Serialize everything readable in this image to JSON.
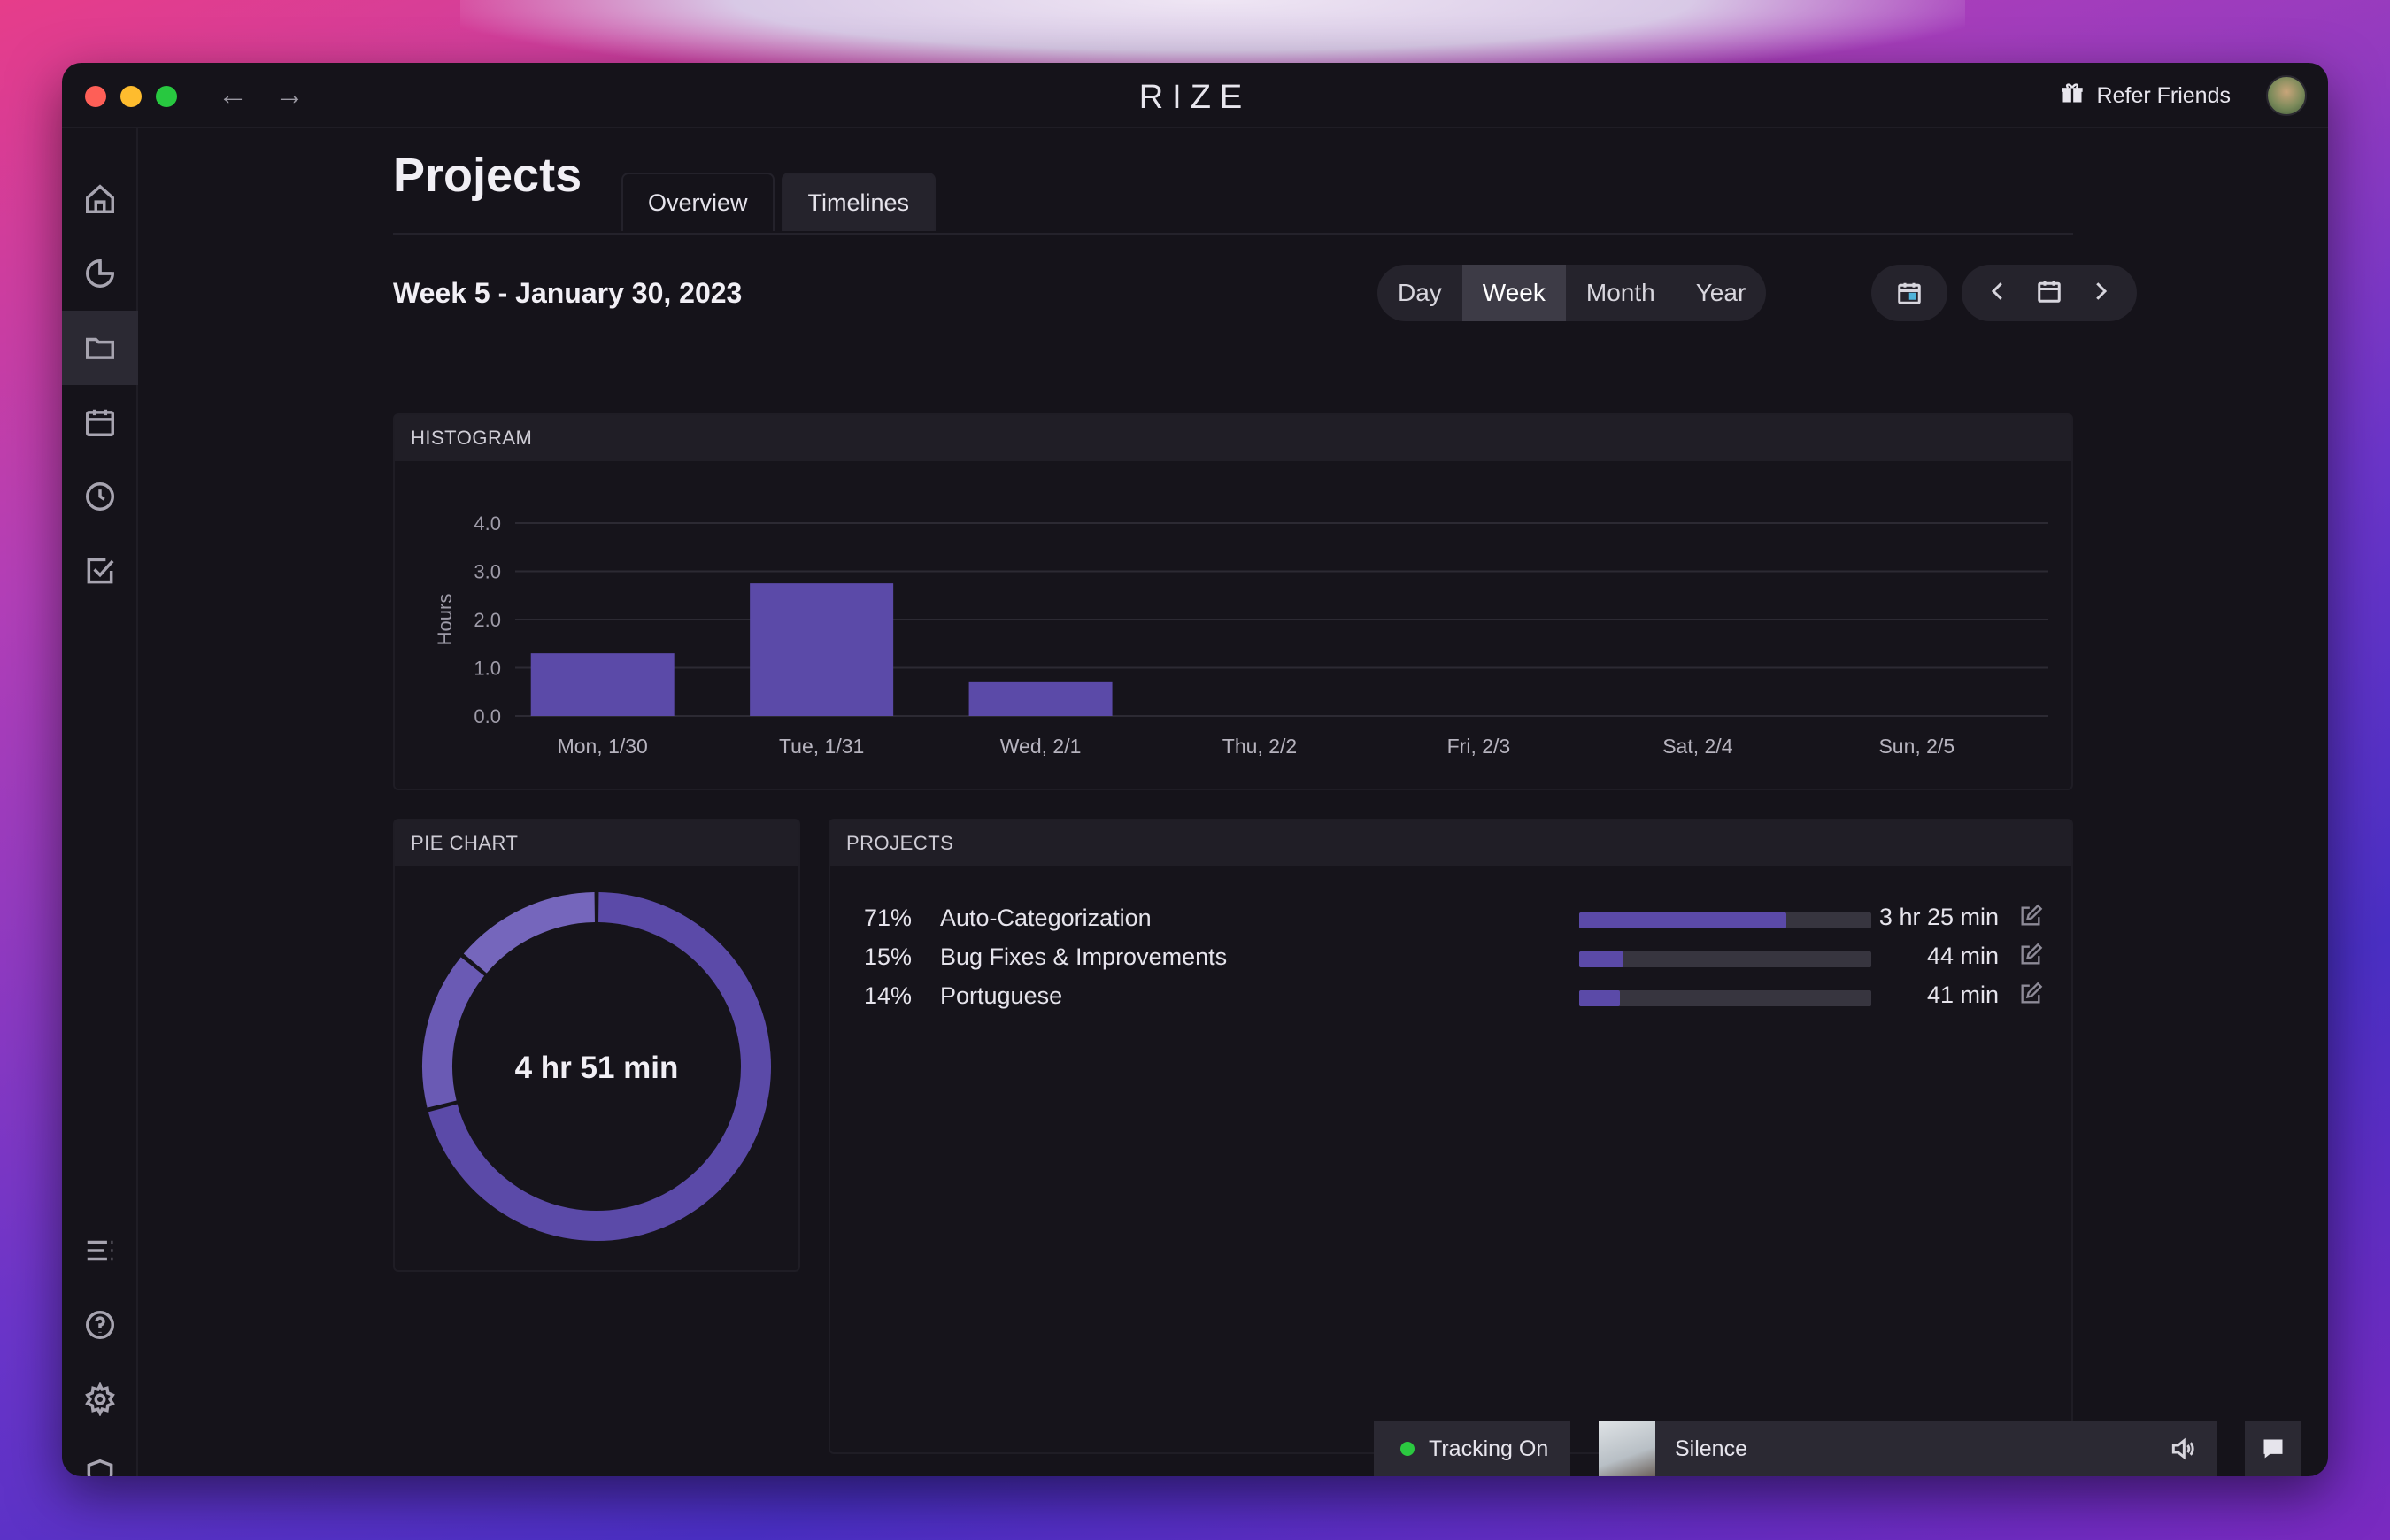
{
  "window": {
    "app_title": "RIZE",
    "refer_label": "Refer Friends"
  },
  "sidebar": {
    "items": [
      {
        "name": "home-icon",
        "active": false
      },
      {
        "name": "pie-chart-icon",
        "active": false
      },
      {
        "name": "folder-icon",
        "active": true
      },
      {
        "name": "calendar-icon",
        "active": false
      },
      {
        "name": "clock-icon",
        "active": false
      },
      {
        "name": "checkbox-icon",
        "active": false
      },
      {
        "name": "list-icon",
        "active": false
      },
      {
        "name": "help-icon",
        "active": false
      },
      {
        "name": "gear-icon",
        "active": false
      },
      {
        "name": "shield-icon",
        "active": false
      }
    ]
  },
  "page": {
    "title": "Projects",
    "tabs": [
      {
        "label": "Overview",
        "active": false
      },
      {
        "label": "Timelines",
        "active": true
      }
    ],
    "week_label": "Week 5 - January 30, 2023",
    "ranges": [
      {
        "label": "Day",
        "active": false
      },
      {
        "label": "Week",
        "active": true
      },
      {
        "label": "Month",
        "active": false
      },
      {
        "label": "Year",
        "active": false
      }
    ]
  },
  "histogram": {
    "header": "HISTOGRAM"
  },
  "chart_data": {
    "type": "bar",
    "ylabel": "Hours",
    "categories": [
      "Mon, 1/30",
      "Tue, 1/31",
      "Wed, 2/1",
      "Thu, 2/2",
      "Fri, 2/3",
      "Sat, 2/4",
      "Sun, 2/5"
    ],
    "values": [
      1.3,
      2.75,
      0.7,
      0,
      0,
      0,
      0
    ],
    "ylim": [
      0,
      4
    ],
    "yticks": [
      "0.0",
      "1.0",
      "2.0",
      "3.0",
      "4.0"
    ],
    "grid": true,
    "bar_color": "#5b4aa8"
  },
  "pie": {
    "header": "PIE CHART",
    "total": "4 hr 51 min",
    "slices": [
      71,
      15,
      14
    ],
    "colors": [
      "#5b4aa8",
      "#6a5ab4",
      "#7566bc"
    ]
  },
  "projects": {
    "header": "PROJECTS",
    "rows": [
      {
        "pct": "71%",
        "name": "Auto-Categorization",
        "fraction": 0.71,
        "duration": "3 hr 25 min"
      },
      {
        "pct": "15%",
        "name": "Bug Fixes & Improvements",
        "fraction": 0.15,
        "duration": "44 min"
      },
      {
        "pct": "14%",
        "name": "Portuguese",
        "fraction": 0.14,
        "duration": "41 min"
      }
    ]
  },
  "status": {
    "tracking_label": "Tracking On",
    "music_label": "Silence"
  },
  "colors": {
    "accent": "#5b4aa8",
    "tracking_dot": "#2bc840"
  }
}
